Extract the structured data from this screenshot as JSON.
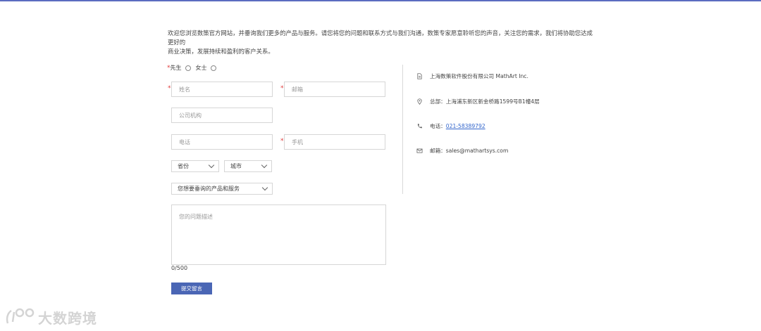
{
  "intro": {
    "line1": "欢迎您浏览数策官方网站，并垂询我们更多的产品与服务。请您将您的问题和联系方式与我们沟通，数策专家愿意聆听您的声音，关注您的需求，我们将协助您达成更好的",
    "line2": "商业决策，发展持续和盈利的客户关系。"
  },
  "form": {
    "required_mark": "*",
    "gender_mr": "先生",
    "gender_ms": "女士",
    "name_placeholder": "姓名",
    "email_placeholder": "邮箱",
    "company_placeholder": "公司机构",
    "phone_placeholder": "电话",
    "mobile_placeholder": "手机",
    "province_label": "省份",
    "city_label": "城市",
    "product_label": "您想要垂询的产品和服务",
    "description_placeholder": "您的问题描述",
    "counter": "0/500",
    "submit_label": "提交留言"
  },
  "contact": {
    "company": "上海数策软件股份有限公司 MathArt Inc.",
    "address": "总部：上海浦东新区新金桥路1599号B1幢4层",
    "phone_prefix": "电话：",
    "phone": "021-58389792",
    "email": "邮箱：sales@mathartsys.com"
  },
  "watermark": {
    "text": "大数跨境"
  },
  "colors": {
    "accent": "#4a66b5",
    "required": "#e03a3a",
    "link": "#3366cc"
  }
}
